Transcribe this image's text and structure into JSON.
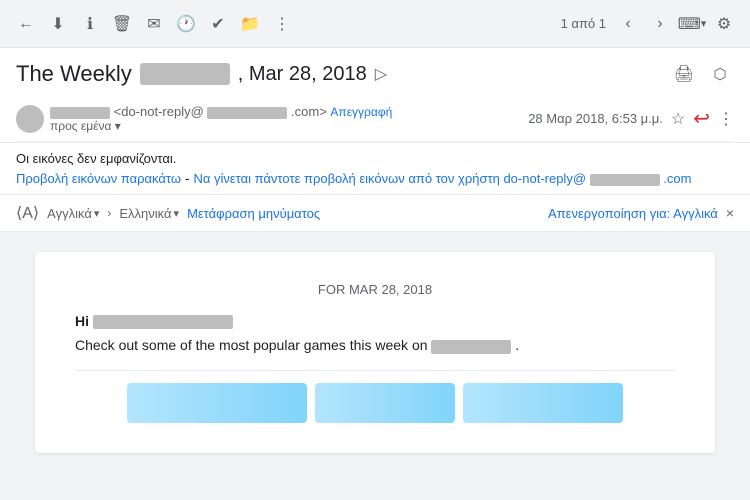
{
  "toolbar": {
    "back_icon": "←",
    "archive_icon": "⬇",
    "spam_icon": "ℹ",
    "delete_icon": "🗑",
    "mark_read_icon": "✉",
    "snooze_icon": "🕐",
    "task_icon": "✔",
    "move_icon": "📁",
    "more_icon": "⋮",
    "pagination": "1 από 1",
    "prev_icon": "‹",
    "next_icon": "›",
    "keyboard_icon": "⌨",
    "settings_icon": "⚙"
  },
  "subject": {
    "title_start": "The Weekly",
    "date_text": ", Mar 28, 2018",
    "forward_icon": "▷",
    "print_icon": "🖨",
    "newwindow_icon": "⬡"
  },
  "sender": {
    "email_display": "<do-not-reply@",
    "domain_display": ".com>",
    "unsubscribe_label": "Απεγγραφή",
    "to_label": "προς εμένα",
    "date_label": "28 Μαρ 2018, 6:53 μ.μ.",
    "star_icon": "☆",
    "reply_icon": "↩",
    "more_icon": "⋮"
  },
  "images_notice": {
    "notice_text": "Οι εικόνες δεν εμφανίζονται.",
    "link_text_1": "Προβολή εικόνων παρακάτω",
    "link_sep": " - ",
    "link_text_2": "Να γίνεται πάντοτε προβολή εικόνων από τον χρήστη do-not-reply@",
    "link_domain": ".com"
  },
  "translation": {
    "from_lang": "Αγγλικά",
    "arrow": "›",
    "to_lang": "Ελληνικά",
    "translate_label": "Μετάφραση μηνύματος",
    "deactivate_label": "Απενεργοποίηση για: Αγγλικά",
    "close_icon": "×"
  },
  "email_content": {
    "date_heading": "FOR MAR 28, 2018",
    "greeting": "Hi",
    "body_text": "Check out some of the most popular games this week on",
    "period": "."
  }
}
